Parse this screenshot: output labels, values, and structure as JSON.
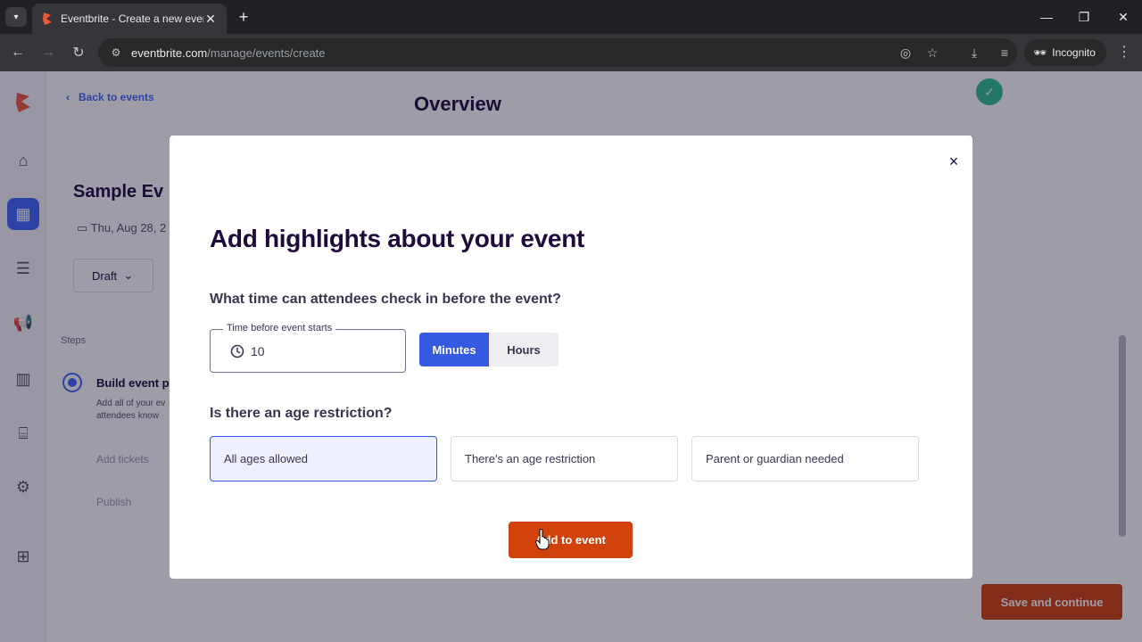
{
  "browser": {
    "tab_title": "Eventbrite - Create a new event",
    "tab_close": "✕",
    "new_tab": "+",
    "url_host": "eventbrite.com",
    "url_path": "/manage/events/create",
    "incognito_label": "Incognito"
  },
  "page": {
    "back_link": "Back to events",
    "title": "Overview",
    "event_name": "Sample Ev",
    "event_date": "Thu, Aug 28, 2",
    "status": "Draft",
    "steps_label": "Steps",
    "step_title": "Build event pa",
    "step_desc": "Add all of your ev attendees know",
    "step_sub_1": "Add tickets",
    "step_sub_2": "Publish",
    "save_continue": "Save and continue"
  },
  "modal": {
    "close": "×",
    "title": "Add highlights about your event",
    "checkin_question": "What time can attendees check in before the event?",
    "time_field": {
      "label": "Time before event starts",
      "value": "10"
    },
    "units": {
      "minutes": "Minutes",
      "hours": "Hours",
      "selected": "Minutes"
    },
    "age_question": "Is there an age restriction?",
    "age_options": [
      "All ages allowed",
      "There's an age restriction",
      "Parent or guardian needed"
    ],
    "age_selected": "All ages allowed",
    "submit": "Add to event"
  },
  "colors": {
    "brand_orange": "#d1410c",
    "accent_blue": "#3659e3",
    "text_dark": "#1e0a3c"
  }
}
